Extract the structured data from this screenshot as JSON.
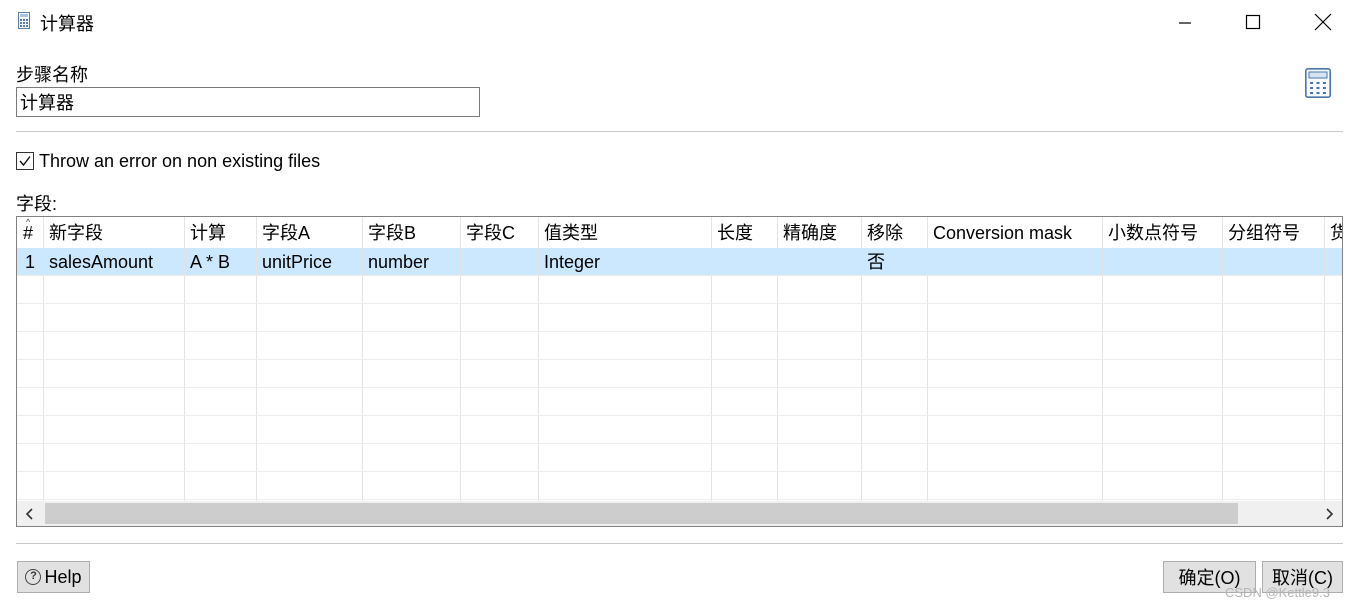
{
  "window": {
    "title": "计算器",
    "icon": "calculator-icon"
  },
  "step": {
    "label": "步骤名称",
    "value": "计算器"
  },
  "options": {
    "throw_error_label": "Throw an error on non existing files",
    "throw_error_checked": true
  },
  "fields": {
    "label": "字段:",
    "columns": [
      "#",
      "新字段",
      "计算",
      "字段A",
      "字段B",
      "字段C",
      "值类型",
      "长度",
      "精确度",
      "移除",
      "Conversion mask",
      "小数点符号",
      "分组符号",
      "货"
    ],
    "rows": [
      [
        "1",
        "salesAmount",
        "A * B",
        "unitPrice",
        "number",
        "",
        "Integer",
        "",
        "",
        "否",
        "",
        "",
        "",
        ""
      ]
    ]
  },
  "buttons": {
    "help": "Help",
    "ok": "确定(O)",
    "cancel": "取消(C)"
  },
  "watermark": "CSDN @Kettle9.3",
  "colors": {
    "selected_row": "#cce8ff",
    "button_face": "#e1e1e1"
  }
}
